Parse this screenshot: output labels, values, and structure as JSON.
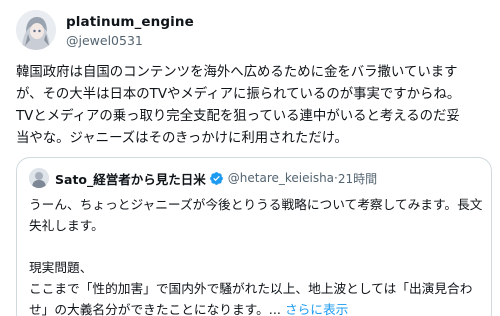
{
  "author": {
    "display_name": "platinum_engine",
    "handle": "@jewel0531"
  },
  "tweet": {
    "lines": [
      "韓国政府は自国のコンテンツを海外へ広めるために金をバラ撒いています",
      "が、その大半は日本のTVやメディアに振られているのが事実ですからね。",
      "TVとメディアの乗っ取り完全支配を狙っている連中がいると考えるのだ妥",
      "当やな。ジャニーズはそのきっかけに利用されただけ。"
    ]
  },
  "quote": {
    "display_name": "Sato_経営者から見た日米",
    "verified": true,
    "handle": "@hetare_keieisha",
    "separator": "·",
    "time": "21時間",
    "lines": [
      "うーん、ちょっとジャニーズが今後とりうる戦略について考察してみます。長文",
      "失礼します。",
      "",
      "現実問題、",
      "ここまで「性的加害」で国内外で騒がれた以上、地上波としては「出演見合わ"
    ],
    "last_line": "せ」の大義名分ができたことになります。...",
    "show_more": "さらに表示"
  },
  "colors": {
    "text": "#0f1419",
    "secondary": "#536471",
    "link": "#1d9bf0",
    "border": "#cfd9de"
  },
  "icons": {
    "verified": "verified-badge-icon"
  }
}
